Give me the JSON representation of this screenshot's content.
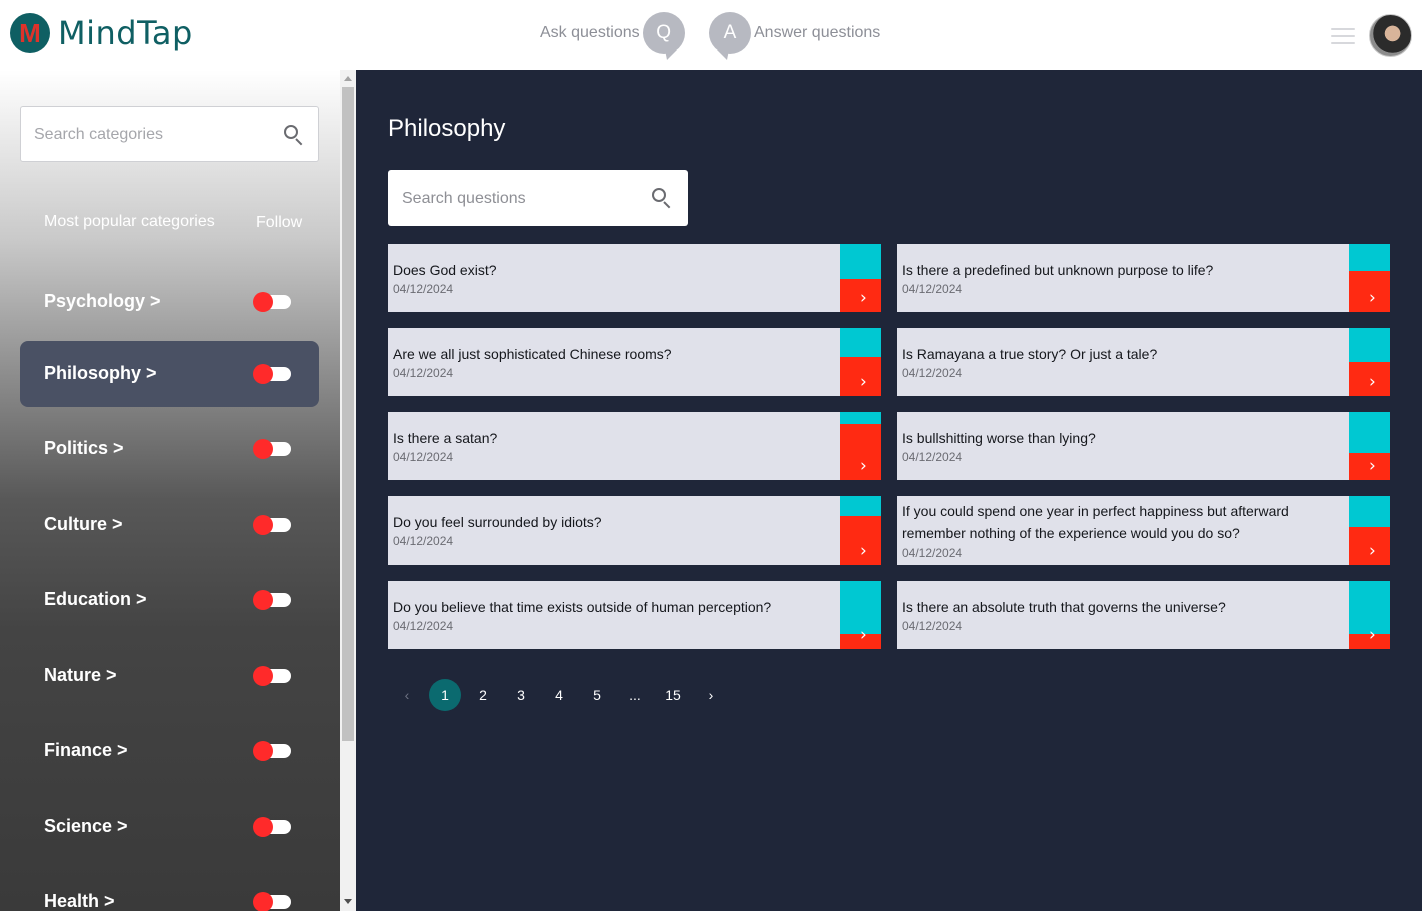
{
  "app": {
    "name": "MindTap",
    "logo_letter": "M",
    "colors": {
      "brand": "#0f5f63",
      "accent_red": "#ff2a12",
      "accent_teal": "#00c8d2",
      "background": "#1f2639"
    }
  },
  "header": {
    "ask_label": "Ask questions",
    "ask_badge": "Q",
    "answer_badge": "A",
    "answer_label": "Answer questions",
    "menu_icon": "hamburger-icon",
    "avatar_icon": "user-avatar"
  },
  "sidebar": {
    "search_placeholder": "Search categories",
    "popular_label": "Most popular categories",
    "follow_label": "Follow",
    "items": [
      {
        "label": "Psychology >",
        "active": false,
        "following": true
      },
      {
        "label": "Philosophy >",
        "active": true,
        "following": true
      },
      {
        "label": "Politics >",
        "active": false,
        "following": true
      },
      {
        "label": "Culture >",
        "active": false,
        "following": true
      },
      {
        "label": "Education >",
        "active": false,
        "following": true
      },
      {
        "label": "Nature >",
        "active": false,
        "following": true
      },
      {
        "label": "Finance >",
        "active": false,
        "following": true
      },
      {
        "label": "Science >",
        "active": false,
        "following": true
      },
      {
        "label": "Health >",
        "active": false,
        "following": true
      }
    ]
  },
  "main": {
    "title": "Philosophy",
    "search_placeholder": "Search questions",
    "questions": [
      {
        "text": "Does God exist?",
        "date": "04/12/2024"
      },
      {
        "text": "Is there a predefined but unknown purpose to life?",
        "date": "04/12/2024"
      },
      {
        "text": "Are we all just sophisticated Chinese rooms?",
        "date": "04/12/2024"
      },
      {
        "text": "Is Ramayana a true story? Or just a tale?",
        "date": "04/12/2024"
      },
      {
        "text": "Is there a satan?",
        "date": "04/12/2024"
      },
      {
        "text": "Is bullshitting worse than lying?",
        "date": "04/12/2024"
      },
      {
        "text": "Do you feel surrounded by idiots?",
        "date": "04/12/2024"
      },
      {
        "text": "If you could spend one year in perfect happiness but afterward remember nothing of the experience would you do so?",
        "date": "04/12/2024"
      },
      {
        "text": "Do you believe that time exists outside of human perception?",
        "date": "04/12/2024"
      },
      {
        "text": "Is there an absolute truth that governs the universe?",
        "date": "04/12/2024"
      }
    ],
    "pagination": {
      "prev": "‹",
      "pages": [
        "1",
        "2",
        "3",
        "4",
        "5",
        "...",
        "15"
      ],
      "current": "1",
      "next": "›"
    }
  }
}
